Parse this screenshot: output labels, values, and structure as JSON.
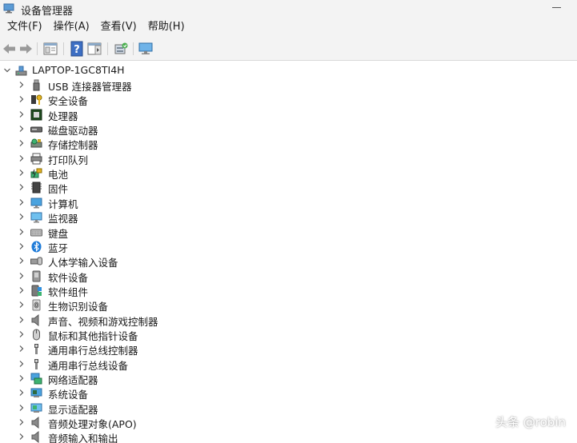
{
  "window": {
    "title": "设备管理器"
  },
  "menu": [
    {
      "label": "文件(F)"
    },
    {
      "label": "操作(A)"
    },
    {
      "label": "查看(V)"
    },
    {
      "label": "帮助(H)"
    }
  ],
  "toolbar": [
    {
      "icon": "back-arrow-icon"
    },
    {
      "icon": "forward-arrow-icon"
    },
    {
      "icon": "properties-icon"
    },
    {
      "icon": "help-icon"
    },
    {
      "icon": "action-pane-icon"
    },
    {
      "icon": "scan-hardware-icon"
    },
    {
      "icon": "monitor-icon"
    }
  ],
  "tree": {
    "root": {
      "label": "LAPTOP-1GC8TI4H",
      "icon": "computer-icon",
      "expanded": true
    },
    "items": [
      {
        "label": "USB 连接器管理器",
        "icon": "usb-icon"
      },
      {
        "label": "安全设备",
        "icon": "security-key-icon"
      },
      {
        "label": "处理器",
        "icon": "processor-icon"
      },
      {
        "label": "磁盘驱动器",
        "icon": "disk-drive-icon"
      },
      {
        "label": "存储控制器",
        "icon": "storage-controller-icon"
      },
      {
        "label": "打印队列",
        "icon": "printer-icon"
      },
      {
        "label": "电池",
        "icon": "battery-icon"
      },
      {
        "label": "固件",
        "icon": "firmware-icon"
      },
      {
        "label": "计算机",
        "icon": "computer-monitor-icon"
      },
      {
        "label": "监视器",
        "icon": "monitor-icon"
      },
      {
        "label": "键盘",
        "icon": "keyboard-icon"
      },
      {
        "label": "蓝牙",
        "icon": "bluetooth-icon"
      },
      {
        "label": "人体学输入设备",
        "icon": "hid-icon"
      },
      {
        "label": "软件设备",
        "icon": "software-device-icon"
      },
      {
        "label": "软件组件",
        "icon": "software-component-icon"
      },
      {
        "label": "生物识别设备",
        "icon": "fingerprint-icon"
      },
      {
        "label": "声音、视频和游戏控制器",
        "icon": "speaker-icon"
      },
      {
        "label": "鼠标和其他指针设备",
        "icon": "mouse-icon"
      },
      {
        "label": "通用串行总线控制器",
        "icon": "usb-controller-icon"
      },
      {
        "label": "通用串行总线设备",
        "icon": "usb-device-icon"
      },
      {
        "label": "网络适配器",
        "icon": "network-adapter-icon"
      },
      {
        "label": "系统设备",
        "icon": "system-device-icon"
      },
      {
        "label": "显示适配器",
        "icon": "display-adapter-icon"
      },
      {
        "label": "音频处理对象(APO)",
        "icon": "audio-processing-icon"
      },
      {
        "label": "音频输入和输出",
        "icon": "audio-io-icon"
      }
    ]
  },
  "watermark": "头条 @robin",
  "colors": {
    "chrome": "#f3f3f3",
    "content": "#ffffff",
    "accent": "#0078d4",
    "separator": "#d9d9d9"
  }
}
